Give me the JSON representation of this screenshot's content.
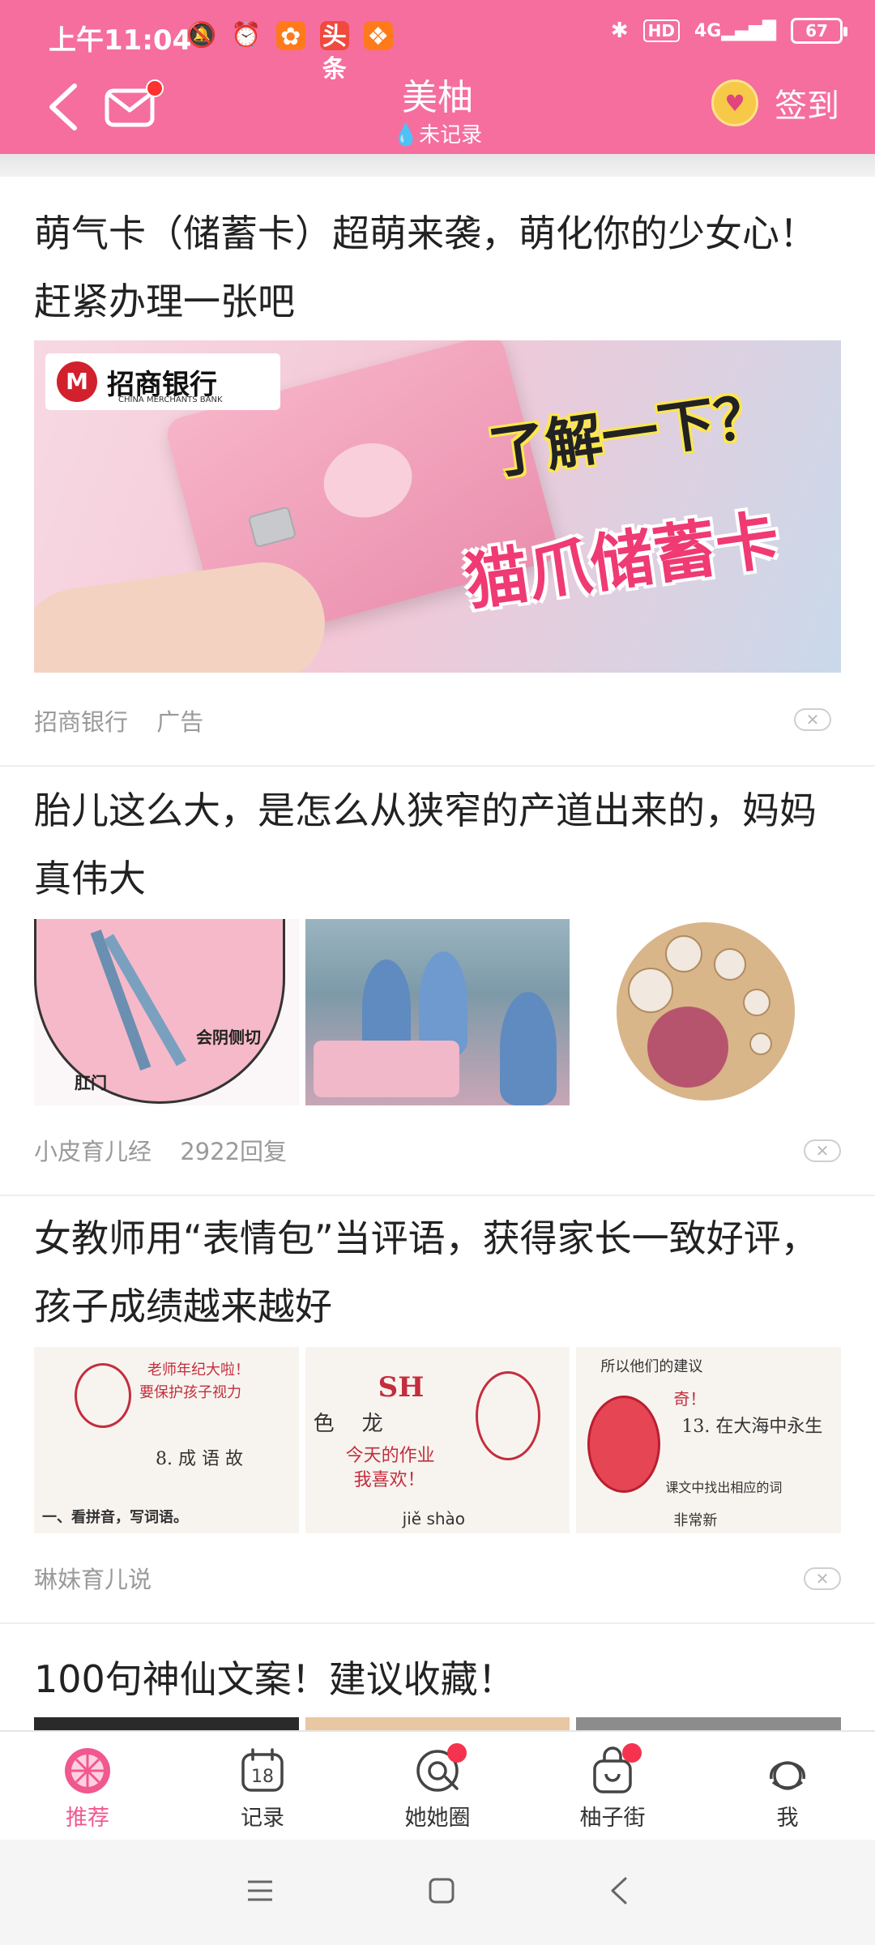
{
  "status_bar": {
    "time": "上午11:04",
    "left_icons": [
      "mute-icon",
      "alarm-icon",
      "app-icon-orange",
      "toutiao-icon",
      "app-icon-orange-2"
    ],
    "toutiao_label": "头条",
    "bluetooth": "bluetooth-icon",
    "hd": "HD",
    "network": "4G",
    "battery": "67"
  },
  "header": {
    "title": "美柚",
    "subtitle": "未记录",
    "checkin_label": "签到",
    "bg_color": "#f56e9e",
    "mail_badge_color": "#ff3131"
  },
  "feed": [
    {
      "title": "萌气卡（储蓄卡）超萌来袭，萌化你的少女心！赶紧办理一张吧",
      "source": "招商银行",
      "tag": "广告",
      "image": {
        "bank_name": "招商银行",
        "bank_name_en": "CHINA MERCHANTS BANK",
        "headline": "了解一下？",
        "product": "猫爪储蓄卡"
      }
    },
    {
      "title": "胎儿这么大，是怎么从狭窄的产道出来的，妈妈真伟大",
      "source": "小皮育儿经",
      "replies": "2922回复",
      "image_labels": [
        "会阴侧切",
        "肛门"
      ]
    },
    {
      "title": "女教师用“表情包”当评语，获得家长一致好评，孩子成绩越来越好",
      "source": "琳妹育儿说",
      "image_texts": {
        "img1": [
          "老师年纪大啦！",
          "要保护孩子视力",
          "8. 成 语 故",
          "一、看拼音，写词语。"
        ],
        "img2": [
          "色",
          "龙",
          "今天的作业",
          "我喜欢！",
          "jiě shào"
        ],
        "img3": [
          "所以他们的建议",
          "奇！",
          "13. 在大海中永生",
          "课文中找出相应的词",
          "非常新"
        ]
      }
    },
    {
      "title": "100句神仙文案！建议收藏！"
    }
  ],
  "tabbar": [
    {
      "label": "推荐",
      "icon": "grapefruit-icon",
      "active": true,
      "badge": false
    },
    {
      "label": "记录",
      "icon": "calendar-icon",
      "active": false,
      "badge": false
    },
    {
      "label": "她她圈",
      "icon": "chat-circle-icon",
      "active": false,
      "badge": true
    },
    {
      "label": "柚子街",
      "icon": "shopping-bag-icon",
      "active": false,
      "badge": true
    },
    {
      "label": "我",
      "icon": "profile-icon",
      "active": false,
      "badge": false
    }
  ],
  "system_nav": [
    "menu-icon",
    "home-icon",
    "back-icon"
  ],
  "colors": {
    "accent": "#f0588f",
    "badge": "#f5334f",
    "meta_text": "#9a9a9a"
  }
}
